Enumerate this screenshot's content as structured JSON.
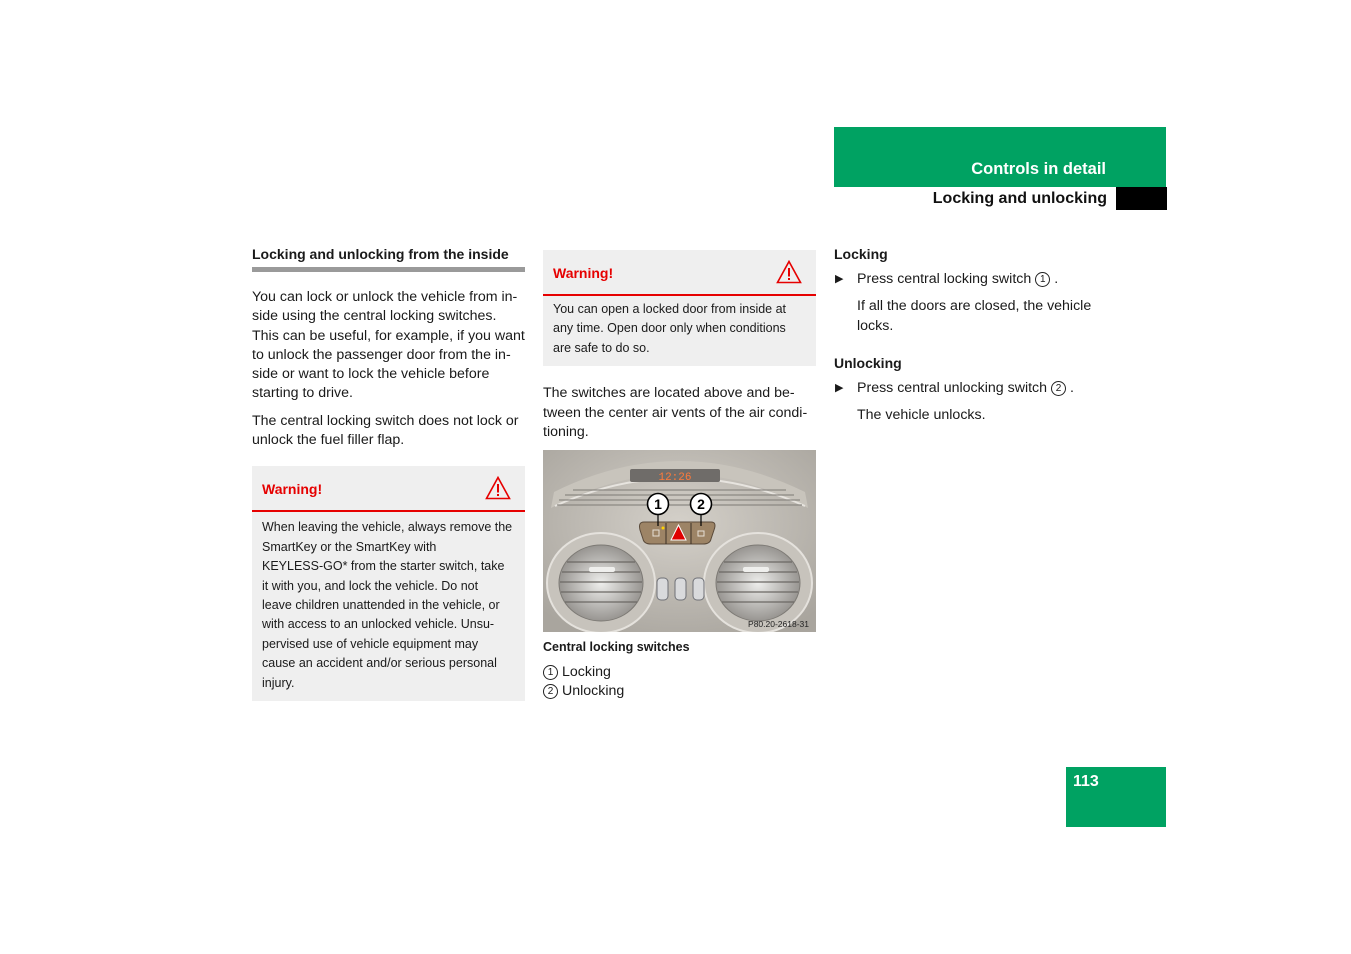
{
  "header": {
    "section": "Controls in detail",
    "subsection": "Locking and unlocking"
  },
  "column1": {
    "title": "Locking and unlocking from the inside",
    "paragraph1": "You can lock or unlock the vehicle from in-side using the central locking switches. This can be useful, for example, if you want to unlock the passenger door from the in-side or want to lock the vehicle before starting to drive.",
    "paragraph1_lines": [
      "You can lock or unlock the vehicle from in-",
      "side using the central locking switches.",
      "This can be useful, for example, if you want",
      "to unlock the passenger door from the in-",
      "side or want to lock the vehicle before",
      "starting to drive."
    ],
    "paragraph2_lines": [
      "The central locking switch does not lock or",
      "unlock the fuel filler flap."
    ],
    "warning": {
      "label": "Warning!",
      "icon": "warning-triangle-icon",
      "lines": [
        "When leaving the vehicle, always remove the",
        "SmartKey or the SmartKey with",
        "KEYLESS-GO* from the starter switch, take",
        "it with you, and lock the vehicle. Do not",
        "leave children unattended in the vehicle, or",
        "with access to an unlocked vehicle. Unsu-",
        "pervised use of vehicle equipment may",
        "cause an accident and/or serious personal",
        "injury."
      ]
    }
  },
  "column2": {
    "warning": {
      "label": "Warning!",
      "icon": "warning-triangle-icon",
      "lines": [
        "You can open a locked door from inside at",
        "any time. Open door only when conditions",
        "are safe to do so."
      ]
    },
    "paragraph_lines": [
      "The switches are located above and be-",
      "tween the center air vents of the air condi-",
      "tioning."
    ],
    "image": {
      "clock": "12:26",
      "callout1": "1",
      "callout2": "2",
      "code": "P80.20-2618-31"
    },
    "caption": "Central locking switches",
    "legend": [
      {
        "num": "1",
        "label": "Locking"
      },
      {
        "num": "2",
        "label": "Unlocking"
      }
    ]
  },
  "column3": {
    "locking": {
      "title": "Locking",
      "step_prefix": "Press central locking switch",
      "step_num": "1",
      "step_suffix": ".",
      "result_lines": [
        "If all the doors are closed, the vehicle",
        "locks."
      ]
    },
    "unlocking": {
      "title": "Unlocking",
      "step_prefix": "Press central unlocking switch",
      "step_num": "2",
      "step_suffix": ".",
      "result": "The vehicle unlocks."
    }
  },
  "page_number": "113",
  "colors": {
    "brand_green": "#00a262",
    "warning_red": "#e60000",
    "box_gray": "#efefef"
  }
}
